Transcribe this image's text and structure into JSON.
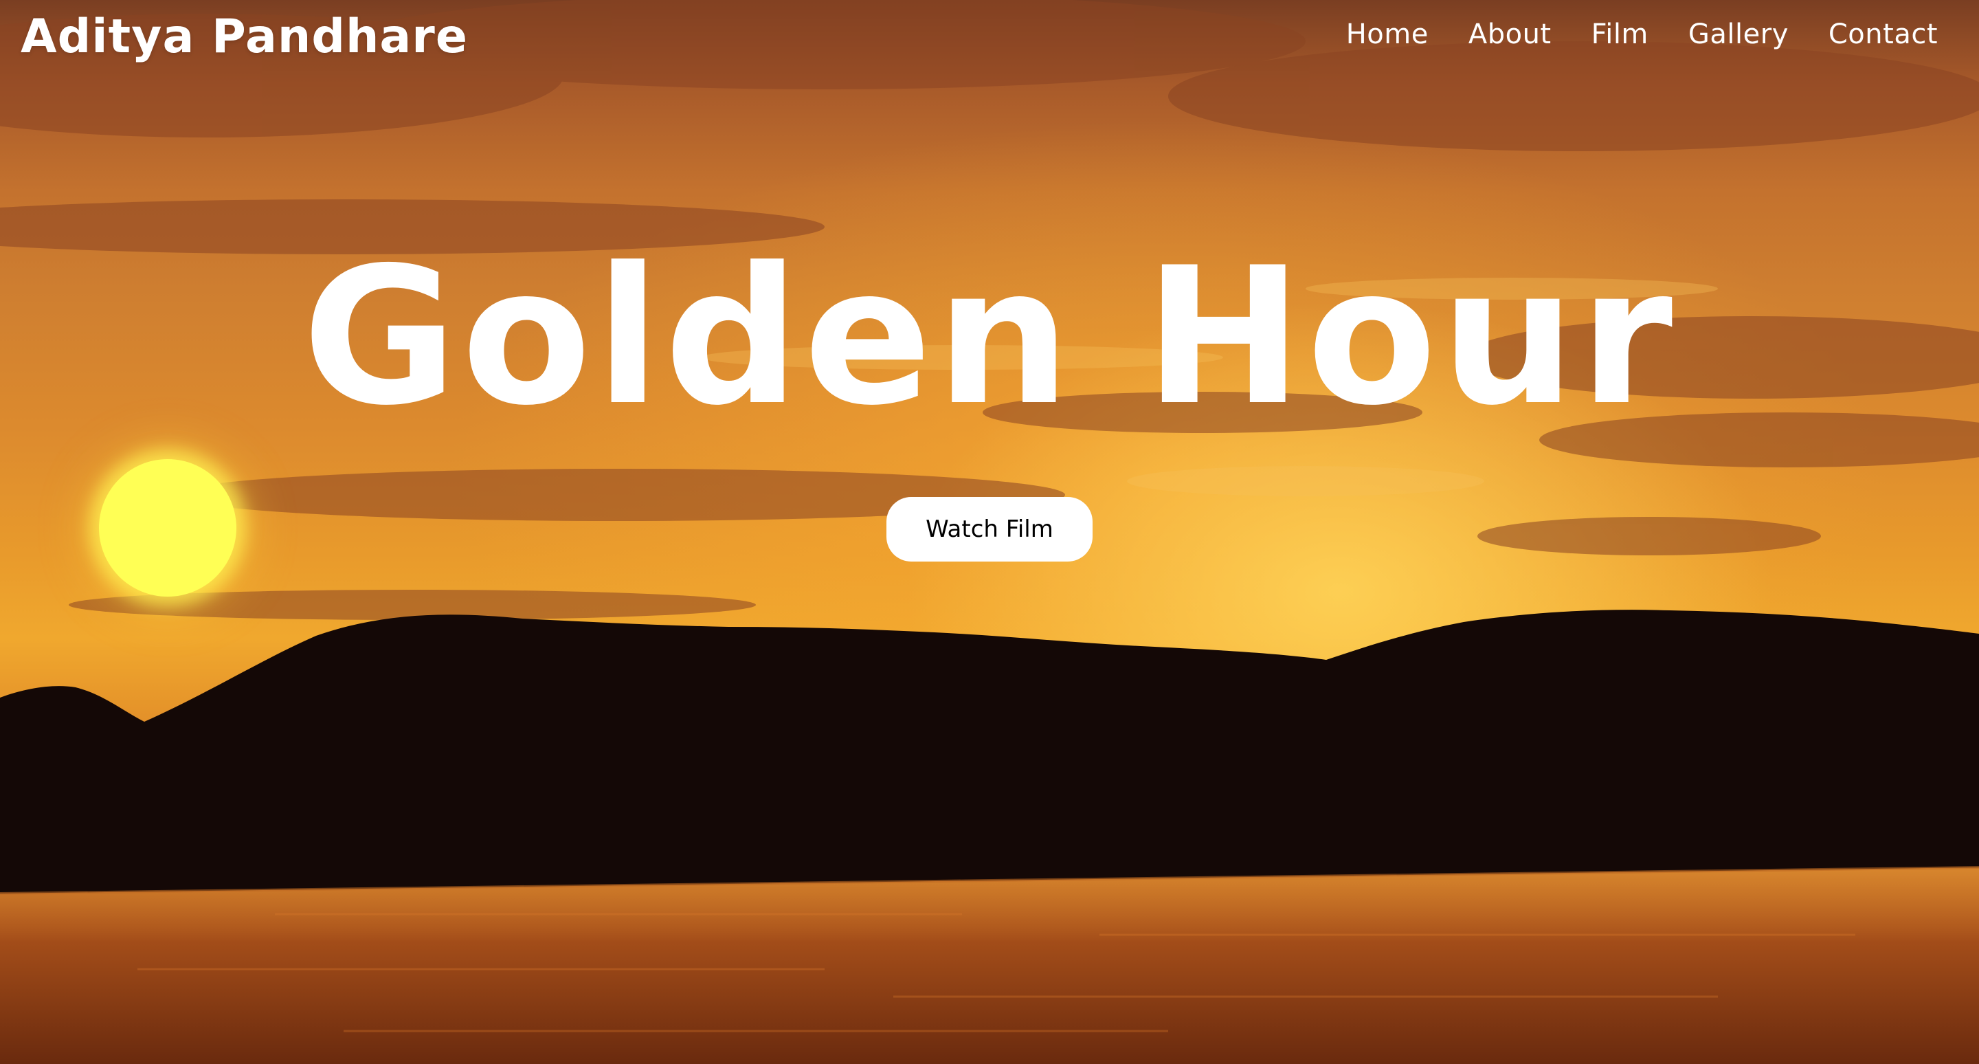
{
  "header": {
    "brand": "Aditya Pandhare"
  },
  "nav": {
    "items": [
      {
        "label": "Home"
      },
      {
        "label": "About"
      },
      {
        "label": "Film"
      },
      {
        "label": "Gallery"
      },
      {
        "label": "Contact"
      }
    ]
  },
  "hero": {
    "title": "Golden Hour",
    "button_label": "Watch Film"
  },
  "colors": {
    "text": "#ffffff",
    "button_bg": "#ffffff",
    "button_text": "#000000",
    "sun": "#ffff55",
    "sky_orange": "#e89a2c",
    "mountain": "#140806"
  }
}
